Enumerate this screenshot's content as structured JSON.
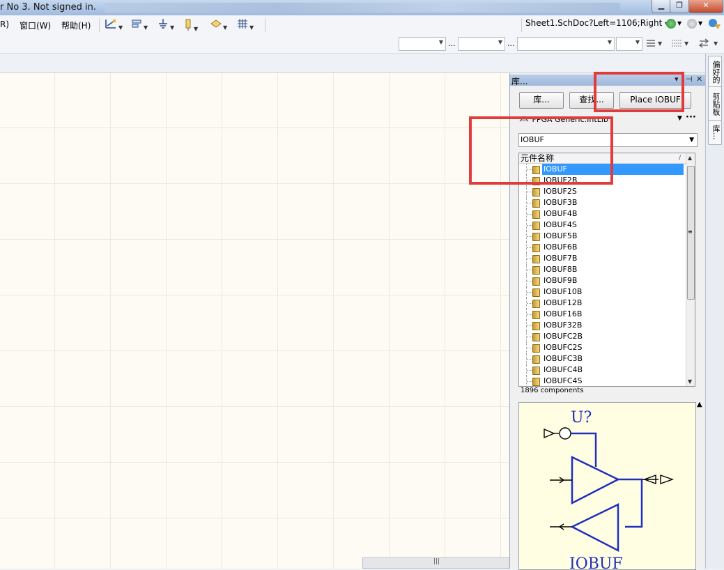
{
  "window": {
    "title": "r No 3. Not signed in.",
    "buttons": {
      "minimize": "▁",
      "maximize": "❐",
      "close": "✕"
    }
  },
  "menu": {
    "items": [
      "R)",
      "窗口(W)",
      "帮助(H)"
    ]
  },
  "address": {
    "text": "Sheet1.SchDoc?Left=1106;Right"
  },
  "toolbar2": {
    "ellipsis": "..."
  },
  "library_panel": {
    "title": "库...",
    "header_controls": {
      "dropdown": "▾",
      "pin": "⊣",
      "close": "✕"
    },
    "buttons": {
      "libraries": "库...",
      "search": "查找...",
      "place": "Place IOBUF"
    },
    "library_name": "FPGA Generic.IntLib",
    "filter_value": "IOBUF",
    "column_header": "元件名称",
    "sort_glyph": "/",
    "components": [
      "IOBUF",
      "IOBUF2B",
      "IOBUF2S",
      "IOBUF3B",
      "IOBUF4B",
      "IOBUF4S",
      "IOBUF5B",
      "IOBUF6B",
      "IOBUF7B",
      "IOBUF8B",
      "IOBUF9B",
      "IOBUF10B",
      "IOBUF12B",
      "IOBUF16B",
      "IOBUF32B",
      "IOBUFC2B",
      "IOBUFC2S",
      "IOBUFC3B",
      "IOBUFC4B",
      "IOBUFC4S"
    ],
    "selected": "IOBUF",
    "count": "1896 components",
    "preview": {
      "designator": "U?",
      "comment": "IOBUF"
    }
  },
  "dock_tabs": [
    "偏好的",
    "剪贴板",
    "库..."
  ],
  "colors": {
    "accent": "#3399ff",
    "annotation": "#e23b3b",
    "schematic_blue": "#1f2fbf"
  }
}
